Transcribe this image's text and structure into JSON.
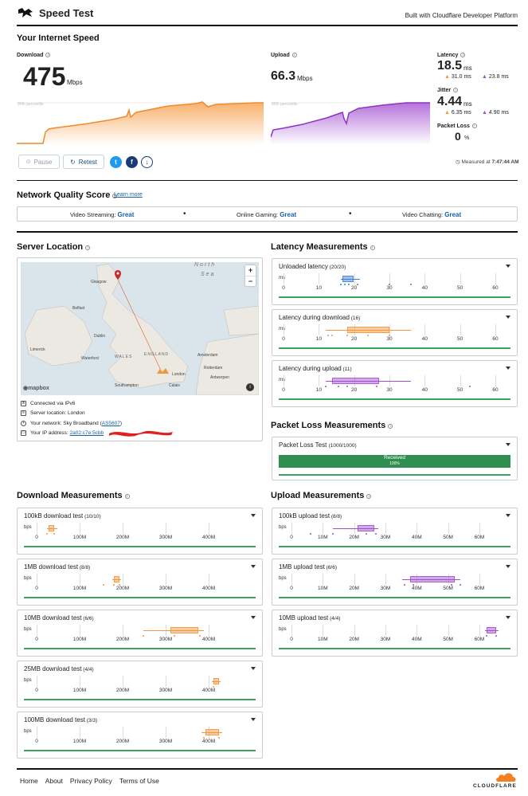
{
  "header": {
    "title": "Speed Test",
    "built_with": "Built with Cloudflare Developer Platform"
  },
  "speed": {
    "section_title": "Your Internet Speed",
    "download_label": "Download",
    "download_value": "475",
    "download_unit": "Mbps",
    "upload_label": "Upload",
    "upload_value": "66.3",
    "upload_unit": "Mbps",
    "percentile": "90th percentile",
    "latency_label": "Latency",
    "latency_value": "18.5",
    "latency_unit": "ms",
    "latency_down": "31.0 ms",
    "latency_up": "23.8 ms",
    "jitter_label": "Jitter",
    "jitter_value": "4.44",
    "jitter_unit": "ms",
    "jitter_down": "6.35 ms",
    "jitter_up": "4.90 ms",
    "packet_loss_label": "Packet Loss",
    "packet_loss_value": "0",
    "packet_loss_unit": "%",
    "pause_label": "Pause",
    "retest_label": "Retest",
    "measured_label": "Measured at",
    "measured_time": "7:47:44 AM"
  },
  "quality": {
    "title": "Network Quality Score",
    "learn_more": "Learn more",
    "items": [
      {
        "label": "Video Streaming:",
        "value": "Great"
      },
      {
        "label": "Online Gaming:",
        "value": "Great"
      },
      {
        "label": "Video Chatting:",
        "value": "Great"
      }
    ]
  },
  "server": {
    "title": "Server Location",
    "map_labels": {
      "north_sea": "North",
      "sea": "Sea",
      "glasgow": "Glasgow",
      "belfast": "Belfast",
      "dublin": "Dublin",
      "limerick": "Limerick",
      "waterford": "Waterford",
      "wales": "WALES",
      "england": "ENGLAND",
      "london": "London",
      "amsterdam": "Amsterdam",
      "rotterdam": "Rotterdam",
      "antwerpen": "Antwerpen",
      "southampton": "Southampton",
      "calais": "Calais",
      "mapbox": "mapbox"
    },
    "info": [
      {
        "icon": "network-icon",
        "text": "Connected via IPv6"
      },
      {
        "icon": "server-icon",
        "text": "Server location: London"
      },
      {
        "icon": "location-pin-icon",
        "text": "Your network: Sky Broadband (",
        "link": "AS5607",
        "suffix": ")"
      },
      {
        "icon": "ip-card-icon",
        "text": "Your IP address: ",
        "link": "2a02:c7e:5cbb"
      }
    ]
  },
  "latency_meas": {
    "title": "Latency Measurements",
    "unit": "ms",
    "ticks": [
      "0",
      "10",
      "20",
      "30",
      "40",
      "50",
      "60"
    ],
    "cards": [
      {
        "title": "Unloaded latency",
        "count": "(20/20)"
      },
      {
        "title": "Latency during download",
        "count": "(16)"
      },
      {
        "title": "Latency during upload",
        "count": "(11)"
      }
    ]
  },
  "packet_loss": {
    "title": "Packet Loss Measurements",
    "card_title": "Packet Loss Test",
    "count": "(1000/1000)",
    "bar_label": "Received",
    "bar_pct": "100%",
    "received_fraction": 1.0
  },
  "download_meas": {
    "title": "Download Measurements",
    "unit": "bps",
    "ticks": [
      "0",
      "100M",
      "200M",
      "300M",
      "400M"
    ],
    "cards": [
      {
        "title": "100kB download test",
        "count": "(10/10)"
      },
      {
        "title": "1MB download test",
        "count": "(8/8)"
      },
      {
        "title": "10MB download test",
        "count": "(6/6)"
      },
      {
        "title": "25MB download test",
        "count": "(4/4)"
      },
      {
        "title": "100MB download test",
        "count": "(3/3)"
      }
    ]
  },
  "upload_meas": {
    "title": "Upload Measurements",
    "unit": "bps",
    "ticks": [
      "0",
      "10M",
      "20M",
      "30M",
      "40M",
      "50M",
      "60M"
    ],
    "cards": [
      {
        "title": "100kB upload test",
        "count": "(8/8)"
      },
      {
        "title": "1MB upload test",
        "count": "(6/6)"
      },
      {
        "title": "10MB upload test",
        "count": "(4/4)"
      }
    ]
  },
  "footer": {
    "links": [
      "Home",
      "About",
      "Privacy Policy",
      "Terms of Use"
    ],
    "brand": "CLOUDFLARE"
  },
  "colors": {
    "download": "#f6963a",
    "upload": "#a24fd0",
    "latency": "#3b7fd4",
    "green": "#2f8f4e",
    "link": "#1660a8"
  }
}
